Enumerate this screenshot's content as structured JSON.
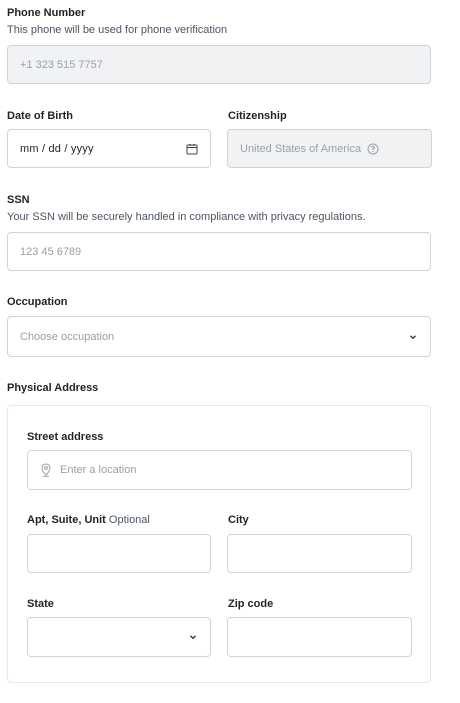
{
  "phone": {
    "label": "Phone Number",
    "hint": "This phone will be used for phone verification",
    "value": "+1 323 515 7757"
  },
  "dob": {
    "label": "Date of Birth",
    "placeholder": "mm / dd / yyyy",
    "icon": "calendar-icon"
  },
  "citizenship": {
    "label": "Citizenship",
    "value": "United States of America",
    "icon": "help-icon"
  },
  "ssn": {
    "label": "SSN",
    "hint": "Your SSN will be securely handled in compliance with privacy regulations.",
    "placeholder": "123 45 6789"
  },
  "occupation": {
    "label": "Occupation",
    "placeholder": "Choose occupation",
    "icon": "chevron-down-icon"
  },
  "address": {
    "section_label": "Physical Address",
    "street": {
      "label": "Street address",
      "placeholder": "Enter a location",
      "icon": "location-pin-icon"
    },
    "apt": {
      "label": "Apt, Suite, Unit",
      "optional": "Optional",
      "value": ""
    },
    "city": {
      "label": "City",
      "value": ""
    },
    "state": {
      "label": "State",
      "value": "",
      "icon": "chevron-down-icon"
    },
    "zip": {
      "label": "Zip code",
      "value": ""
    }
  },
  "colors": {
    "border": "#d0d4da",
    "disabled_bg": "#f1f2f4",
    "placeholder": "#9aa0a8",
    "text": "#1f2328"
  }
}
